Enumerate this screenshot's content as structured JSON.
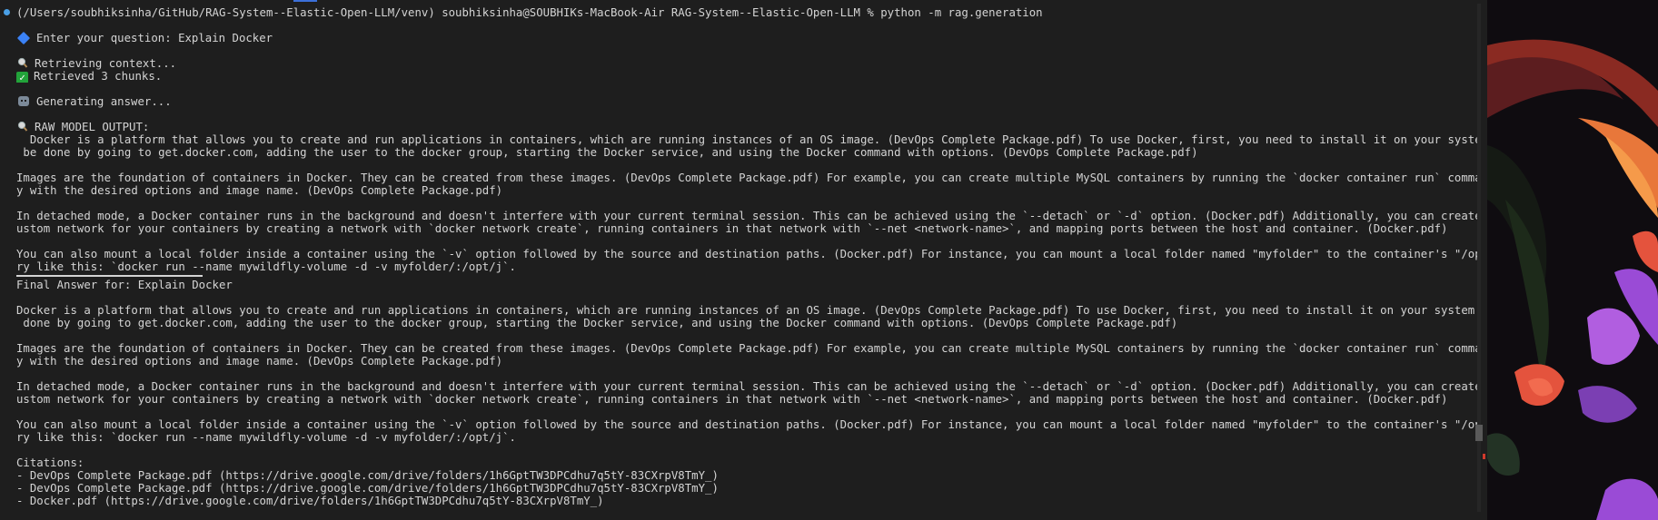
{
  "terminal": {
    "prompt_line": "(/Users/soubhiksinha/GitHub/RAG-System--Elastic-Open-LLM/venv) soubhiksinha@SOUBHIKs-MacBook-Air RAG-System--Elastic-Open-LLM % python -m rag.generation",
    "question_line": "Enter your question: Explain Docker",
    "retrieving_line": "Retrieving context...",
    "retrieved_line": "Retrieved 3 chunks.",
    "generating_line": "Generating answer...",
    "raw_header": "RAW MODEL OUTPUT:",
    "raw_p1_l1": "  Docker is a platform that allows you to create and run applications in containers, which are running instances of an OS image. (DevOps Complete Package.pdf) To use Docker, first, you need to install it on your system. This can",
    "raw_p1_l2": " be done by going to get.docker.com, adding the user to the docker group, starting the Docker service, and using the Docker command with options. (DevOps Complete Package.pdf)",
    "raw_p2_l1": "Images are the foundation of containers in Docker. They can be created from these images. (DevOps Complete Package.pdf) For example, you can create multiple MySQL containers by running the `docker container run` command repeatedl",
    "raw_p2_l2": "y with the desired options and image name. (DevOps Complete Package.pdf)",
    "raw_p3_l1": "In detached mode, a Docker container runs in the background and doesn't interfere with your current terminal session. This can be achieved using the `--detach` or `-d` option. (Docker.pdf) Additionally, you can create and use a c",
    "raw_p3_l2": "ustom network for your containers by creating a network with `docker network create`, running containers in that network with `--net <network-name>`, and mapping ports between the host and container. (Docker.pdf)",
    "raw_p4_l1": "You can also mount a local folder inside a container using the `-v` option followed by the source and destination paths. (Docker.pdf) For instance, you can mount a local folder named \"myfolder\" to the container's \"/opt/j\" directo",
    "raw_p4_l2": "ry like this: `docker run --name mywildfly-volume -d -v myfolder/:/opt/j`.",
    "final_header": "Final Answer for: Explain Docker",
    "final_p1_l1": "Docker is a platform that allows you to create and run applications in containers, which are running instances of an OS image. (DevOps Complete Package.pdf) To use Docker, first, you need to install it on your system. This can be",
    "final_p1_l2": " done by going to get.docker.com, adding the user to the docker group, starting the Docker service, and using the Docker command with options. (DevOps Complete Package.pdf)",
    "final_p2_l1": "Images are the foundation of containers in Docker. They can be created from these images. (DevOps Complete Package.pdf) For example, you can create multiple MySQL containers by running the `docker container run` command repeatedl",
    "final_p2_l2": "y with the desired options and image name. (DevOps Complete Package.pdf)",
    "final_p3_l1": "In detached mode, a Docker container runs in the background and doesn't interfere with your current terminal session. This can be achieved using the `--detach` or `-d` option. (Docker.pdf) Additionally, you can create and use a c",
    "final_p3_l2": "ustom network for your containers by creating a network with `docker network create`, running containers in that network with `--net <network-name>`, and mapping ports between the host and container. (Docker.pdf)",
    "final_p4_l1": "You can also mount a local folder inside a container using the `-v` option followed by the source and destination paths. (Docker.pdf) For instance, you can mount a local folder named \"myfolder\" to the container's \"/opt/j\" directo",
    "final_p4_l2": "ry like this: `docker run --name mywildfly-volume -d -v myfolder/:/opt/j`.",
    "citations_header": "Citations:",
    "citations": [
      "- DevOps Complete Package.pdf (https://drive.google.com/drive/folders/1h6GptTW3DPCdhu7q5tY-83CXrpV8TmY_)",
      "- DevOps Complete Package.pdf (https://drive.google.com/drive/folders/1h6GptTW3DPCdhu7q5tY-83CXrpV8TmY_)",
      "- Docker.pdf (https://drive.google.com/drive/folders/1h6GptTW3DPCdhu7q5tY-83CXrpV8TmY_)"
    ]
  },
  "icons": {
    "question": "blue-diamond-icon",
    "retrieving": "magnifier-icon",
    "retrieved": "check-icon",
    "generating": "robot-icon",
    "raw": "magnifier-icon"
  },
  "colors": {
    "terminal_bg": "#1e1e1e",
    "text": "#d4d4d4",
    "accent": "#3b82f6",
    "success": "#22a33a"
  }
}
